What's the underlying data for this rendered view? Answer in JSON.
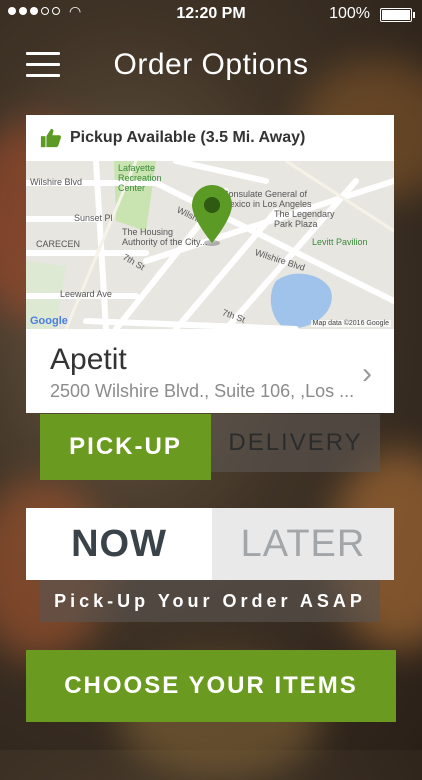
{
  "status_bar": {
    "time": "12:20 PM",
    "battery": "100%"
  },
  "header": {
    "title": "Order Options",
    "menu_icon": "hamburger-menu-icon"
  },
  "location": {
    "availability": "Pickup Available (3.5 Mi. Away)",
    "availability_icon": "thumbs-up-icon",
    "restaurant_name": "Apetit",
    "restaurant_address": "2500 Wilshire Blvd., Suite 106, ,Los ...",
    "chevron_icon": "chevron-right-icon",
    "map": {
      "labels": {
        "wilshire_left": "Wilshire Blvd",
        "lafayette": "Lafayette\nRecreation\nCenter",
        "consulate": "Consulate General of\nMexico in Los Angeles",
        "legendary": "The Legendary\nPark Plaza",
        "sunset": "Sunset Pl",
        "housing": "The Housing\nAuthority of the City...",
        "carecen": "CARECEN",
        "levitt": "Levitt Pavilion",
        "seventh_left": "7th St",
        "wilshire_right": "Wilshire Blvd",
        "leeward": "Leeward Ave",
        "seventh_right": "7th St",
        "wilshire_mid": "Wilshire"
      },
      "credit": "Map data ©2016 Google",
      "google": "Google"
    }
  },
  "order_mode": {
    "pickup_label": "PICK-UP",
    "delivery_label": "DELIVERY",
    "selected": "PICK-UP"
  },
  "order_time": {
    "now_label": "NOW",
    "later_label": "LATER",
    "selected": "NOW"
  },
  "hint": "Pick-Up Your Order ASAP",
  "cta": "CHOOSE YOUR ITEMS",
  "colors": {
    "accent": "#6a9a1f",
    "pin": "#5b9a25"
  }
}
